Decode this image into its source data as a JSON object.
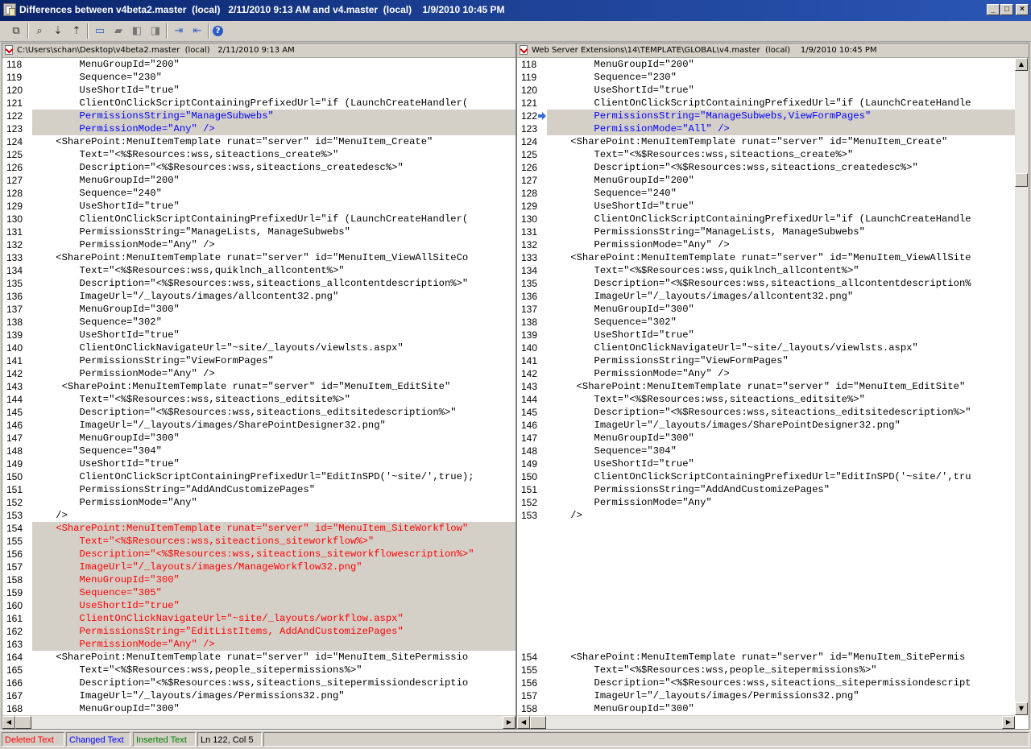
{
  "window": {
    "title": "Differences between v4beta2.master  (local)   2/11/2010 9:13 AM and v4.master  (local)    1/9/2010 10:45 PM",
    "minimize_glyph": "_",
    "maximize_glyph": "□",
    "close_glyph": "×"
  },
  "toolbar": {
    "buttons": [
      {
        "name": "copy-icon",
        "glyph": "⧉"
      },
      {
        "name": "find-icon",
        "glyph": "⌕"
      },
      {
        "name": "find-next-icon",
        "glyph": "⇣"
      },
      {
        "name": "find-prev-icon",
        "glyph": "⇡"
      },
      {
        "name": "view-icon",
        "glyph": "▭"
      },
      {
        "name": "comment-icon",
        "glyph": "▰"
      },
      {
        "name": "comment-prev-icon",
        "glyph": "◧"
      },
      {
        "name": "comment-next-icon",
        "glyph": "◨"
      },
      {
        "name": "next-difference-icon",
        "glyph": "⇥"
      },
      {
        "name": "prev-difference-icon",
        "glyph": "⇤"
      },
      {
        "name": "help-icon",
        "glyph": "?"
      }
    ]
  },
  "colors": {
    "deleted": "#ff0000",
    "changed": "#0000ff",
    "inserted": "#008000",
    "diff_background": "#d4d0c8"
  },
  "left_pane": {
    "header": "C:\\Users\\schan\\Desktop\\v4beta2.master  (local)   2/11/2010 9:13 AM",
    "lines": [
      {
        "n": "118",
        "t": "        MenuGroupId=\"200\"",
        "s": ""
      },
      {
        "n": "119",
        "t": "        Sequence=\"230\"",
        "s": ""
      },
      {
        "n": "120",
        "t": "        UseShortId=\"true\"",
        "s": ""
      },
      {
        "n": "121",
        "t": "        ClientOnClickScriptContainingPrefixedUrl=\"if (LaunchCreateHandler(",
        "s": ""
      },
      {
        "n": "122",
        "t": "        PermissionsString=\"ManageSubwebs\"",
        "s": "changed"
      },
      {
        "n": "123",
        "t": "        PermissionMode=\"Any\" />",
        "s": "changed"
      },
      {
        "n": "124",
        "t": "    <SharePoint:MenuItemTemplate runat=\"server\" id=\"MenuItem_Create\"",
        "s": ""
      },
      {
        "n": "125",
        "t": "        Text=\"<%$Resources:wss,siteactions_create%>\"",
        "s": ""
      },
      {
        "n": "126",
        "t": "        Description=\"<%$Resources:wss,siteactions_createdesc%>\"",
        "s": ""
      },
      {
        "n": "127",
        "t": "        MenuGroupId=\"200\"",
        "s": ""
      },
      {
        "n": "128",
        "t": "        Sequence=\"240\"",
        "s": ""
      },
      {
        "n": "129",
        "t": "        UseShortId=\"true\"",
        "s": ""
      },
      {
        "n": "130",
        "t": "        ClientOnClickScriptContainingPrefixedUrl=\"if (LaunchCreateHandler(",
        "s": ""
      },
      {
        "n": "131",
        "t": "        PermissionsString=\"ManageLists, ManageSubwebs\"",
        "s": ""
      },
      {
        "n": "132",
        "t": "        PermissionMode=\"Any\" />",
        "s": ""
      },
      {
        "n": "133",
        "t": "    <SharePoint:MenuItemTemplate runat=\"server\" id=\"MenuItem_ViewAllSiteCo",
        "s": ""
      },
      {
        "n": "134",
        "t": "        Text=\"<%$Resources:wss,quiklnch_allcontent%>\"",
        "s": ""
      },
      {
        "n": "135",
        "t": "        Description=\"<%$Resources:wss,siteactions_allcontentdescription%>\"",
        "s": ""
      },
      {
        "n": "136",
        "t": "        ImageUrl=\"/_layouts/images/allcontent32.png\"",
        "s": ""
      },
      {
        "n": "137",
        "t": "        MenuGroupId=\"300\"",
        "s": ""
      },
      {
        "n": "138",
        "t": "        Sequence=\"302\"",
        "s": ""
      },
      {
        "n": "139",
        "t": "        UseShortId=\"true\"",
        "s": ""
      },
      {
        "n": "140",
        "t": "        ClientOnClickNavigateUrl=\"~site/_layouts/viewlsts.aspx\"",
        "s": ""
      },
      {
        "n": "141",
        "t": "        PermissionsString=\"ViewFormPages\"",
        "s": ""
      },
      {
        "n": "142",
        "t": "        PermissionMode=\"Any\" />",
        "s": ""
      },
      {
        "n": "143",
        "t": "     <SharePoint:MenuItemTemplate runat=\"server\" id=\"MenuItem_EditSite\"",
        "s": ""
      },
      {
        "n": "144",
        "t": "        Text=\"<%$Resources:wss,siteactions_editsite%>\"",
        "s": ""
      },
      {
        "n": "145",
        "t": "        Description=\"<%$Resources:wss,siteactions_editsitedescription%>\"",
        "s": ""
      },
      {
        "n": "146",
        "t": "        ImageUrl=\"/_layouts/images/SharePointDesigner32.png\"",
        "s": ""
      },
      {
        "n": "147",
        "t": "        MenuGroupId=\"300\"",
        "s": ""
      },
      {
        "n": "148",
        "t": "        Sequence=\"304\"",
        "s": ""
      },
      {
        "n": "149",
        "t": "        UseShortId=\"true\"",
        "s": ""
      },
      {
        "n": "150",
        "t": "        ClientOnClickScriptContainingPrefixedUrl=\"EditInSPD('~site/',true);",
        "s": ""
      },
      {
        "n": "151",
        "t": "        PermissionsString=\"AddAndCustomizePages\"",
        "s": ""
      },
      {
        "n": "152",
        "t": "        PermissionMode=\"Any\"",
        "s": ""
      },
      {
        "n": "153",
        "t": "    />",
        "s": ""
      },
      {
        "n": "154",
        "t": "    <SharePoint:MenuItemTemplate runat=\"server\" id=\"MenuItem_SiteWorkflow\"",
        "s": "deleted"
      },
      {
        "n": "155",
        "t": "        Text=\"<%$Resources:wss,siteactions_siteworkflow%>\"",
        "s": "deleted"
      },
      {
        "n": "156",
        "t": "        Description=\"<%$Resources:wss,siteactions_siteworkflowescription%>\"",
        "s": "deleted"
      },
      {
        "n": "157",
        "t": "        ImageUrl=\"/_layouts/images/ManageWorkflow32.png\"",
        "s": "deleted"
      },
      {
        "n": "158",
        "t": "        MenuGroupId=\"300\"",
        "s": "deleted"
      },
      {
        "n": "159",
        "t": "        Sequence=\"305\"",
        "s": "deleted"
      },
      {
        "n": "160",
        "t": "        UseShortId=\"true\"",
        "s": "deleted"
      },
      {
        "n": "161",
        "t": "        ClientOnClickNavigateUrl=\"~site/_layouts/workflow.aspx\"",
        "s": "deleted"
      },
      {
        "n": "162",
        "t": "        PermissionsString=\"EditListItems, AddAndCustomizePages\"",
        "s": "deleted"
      },
      {
        "n": "163",
        "t": "        PermissionMode=\"Any\" />",
        "s": "deleted"
      },
      {
        "n": "164",
        "t": "    <SharePoint:MenuItemTemplate runat=\"server\" id=\"MenuItem_SitePermissio",
        "s": ""
      },
      {
        "n": "165",
        "t": "        Text=\"<%$Resources:wss,people_sitepermissions%>\"",
        "s": ""
      },
      {
        "n": "166",
        "t": "        Description=\"<%$Resources:wss,siteactions_sitepermissiondescriptio",
        "s": ""
      },
      {
        "n": "167",
        "t": "        ImageUrl=\"/_layouts/images/Permissions32.png\"",
        "s": ""
      },
      {
        "n": "168",
        "t": "        MenuGroupId=\"300\"",
        "s": ""
      }
    ]
  },
  "right_pane": {
    "header": "Web Server Extensions\\14\\TEMPLATE\\GLOBAL\\v4.master  (local)    1/9/2010 10:45 PM",
    "lines": [
      {
        "n": "118",
        "t": "        MenuGroupId=\"200\"",
        "s": ""
      },
      {
        "n": "119",
        "t": "        Sequence=\"230\"",
        "s": ""
      },
      {
        "n": "120",
        "t": "        UseShortId=\"true\"",
        "s": ""
      },
      {
        "n": "121",
        "t": "        ClientOnClickScriptContainingPrefixedUrl=\"if (LaunchCreateHandle",
        "s": ""
      },
      {
        "n": "122",
        "t": "        PermissionsString=\"ManageSubwebs,ViewFormPages\"",
        "s": "changed",
        "marker": true
      },
      {
        "n": "123",
        "t": "        PermissionMode=\"All\" />",
        "s": "changed"
      },
      {
        "n": "124",
        "t": "    <SharePoint:MenuItemTemplate runat=\"server\" id=\"MenuItem_Create\"",
        "s": ""
      },
      {
        "n": "125",
        "t": "        Text=\"<%$Resources:wss,siteactions_create%>\"",
        "s": ""
      },
      {
        "n": "126",
        "t": "        Description=\"<%$Resources:wss,siteactions_createdesc%>\"",
        "s": ""
      },
      {
        "n": "127",
        "t": "        MenuGroupId=\"200\"",
        "s": ""
      },
      {
        "n": "128",
        "t": "        Sequence=\"240\"",
        "s": ""
      },
      {
        "n": "129",
        "t": "        UseShortId=\"true\"",
        "s": ""
      },
      {
        "n": "130",
        "t": "        ClientOnClickScriptContainingPrefixedUrl=\"if (LaunchCreateHandle",
        "s": ""
      },
      {
        "n": "131",
        "t": "        PermissionsString=\"ManageLists, ManageSubwebs\"",
        "s": ""
      },
      {
        "n": "132",
        "t": "        PermissionMode=\"Any\" />",
        "s": ""
      },
      {
        "n": "133",
        "t": "    <SharePoint:MenuItemTemplate runat=\"server\" id=\"MenuItem_ViewAllSite",
        "s": ""
      },
      {
        "n": "134",
        "t": "        Text=\"<%$Resources:wss,quiklnch_allcontent%>\"",
        "s": ""
      },
      {
        "n": "135",
        "t": "        Description=\"<%$Resources:wss,siteactions_allcontentdescription%",
        "s": ""
      },
      {
        "n": "136",
        "t": "        ImageUrl=\"/_layouts/images/allcontent32.png\"",
        "s": ""
      },
      {
        "n": "137",
        "t": "        MenuGroupId=\"300\"",
        "s": ""
      },
      {
        "n": "138",
        "t": "        Sequence=\"302\"",
        "s": ""
      },
      {
        "n": "139",
        "t": "        UseShortId=\"true\"",
        "s": ""
      },
      {
        "n": "140",
        "t": "        ClientOnClickNavigateUrl=\"~site/_layouts/viewlsts.aspx\"",
        "s": ""
      },
      {
        "n": "141",
        "t": "        PermissionsString=\"ViewFormPages\"",
        "s": ""
      },
      {
        "n": "142",
        "t": "        PermissionMode=\"Any\" />",
        "s": ""
      },
      {
        "n": "143",
        "t": "     <SharePoint:MenuItemTemplate runat=\"server\" id=\"MenuItem_EditSite\"",
        "s": ""
      },
      {
        "n": "144",
        "t": "        Text=\"<%$Resources:wss,siteactions_editsite%>\"",
        "s": ""
      },
      {
        "n": "145",
        "t": "        Description=\"<%$Resources:wss,siteactions_editsitedescription%>\"",
        "s": ""
      },
      {
        "n": "146",
        "t": "        ImageUrl=\"/_layouts/images/SharePointDesigner32.png\"",
        "s": ""
      },
      {
        "n": "147",
        "t": "        MenuGroupId=\"300\"",
        "s": ""
      },
      {
        "n": "148",
        "t": "        Sequence=\"304\"",
        "s": ""
      },
      {
        "n": "149",
        "t": "        UseShortId=\"true\"",
        "s": ""
      },
      {
        "n": "150",
        "t": "        ClientOnClickScriptContainingPrefixedUrl=\"EditInSPD('~site/',tru",
        "s": ""
      },
      {
        "n": "151",
        "t": "        PermissionsString=\"AddAndCustomizePages\"",
        "s": ""
      },
      {
        "n": "152",
        "t": "        PermissionMode=\"Any\"",
        "s": ""
      },
      {
        "n": "153",
        "t": "    />",
        "s": ""
      },
      {
        "n": "",
        "t": "",
        "s": "blank"
      },
      {
        "n": "",
        "t": "",
        "s": "blank"
      },
      {
        "n": "",
        "t": "",
        "s": "blank"
      },
      {
        "n": "",
        "t": "",
        "s": "blank"
      },
      {
        "n": "",
        "t": "",
        "s": "blank"
      },
      {
        "n": "",
        "t": "",
        "s": "blank"
      },
      {
        "n": "",
        "t": "",
        "s": "blank"
      },
      {
        "n": "",
        "t": "",
        "s": "blank"
      },
      {
        "n": "",
        "t": "",
        "s": "blank"
      },
      {
        "n": "",
        "t": "",
        "s": "blank"
      },
      {
        "n": "154",
        "t": "    <SharePoint:MenuItemTemplate runat=\"server\" id=\"MenuItem_SitePermis",
        "s": ""
      },
      {
        "n": "155",
        "t": "        Text=\"<%$Resources:wss,people_sitepermissions%>\"",
        "s": ""
      },
      {
        "n": "156",
        "t": "        Description=\"<%$Resources:wss,siteactions_sitepermissiondescript",
        "s": ""
      },
      {
        "n": "157",
        "t": "        ImageUrl=\"/_layouts/images/Permissions32.png\"",
        "s": ""
      },
      {
        "n": "158",
        "t": "        MenuGroupId=\"300\"",
        "s": ""
      }
    ]
  },
  "statusbar": {
    "deleted_label": "Deleted Text",
    "changed_label": "Changed Text",
    "inserted_label": "Inserted Text",
    "position": "Ln 122, Col 5"
  }
}
